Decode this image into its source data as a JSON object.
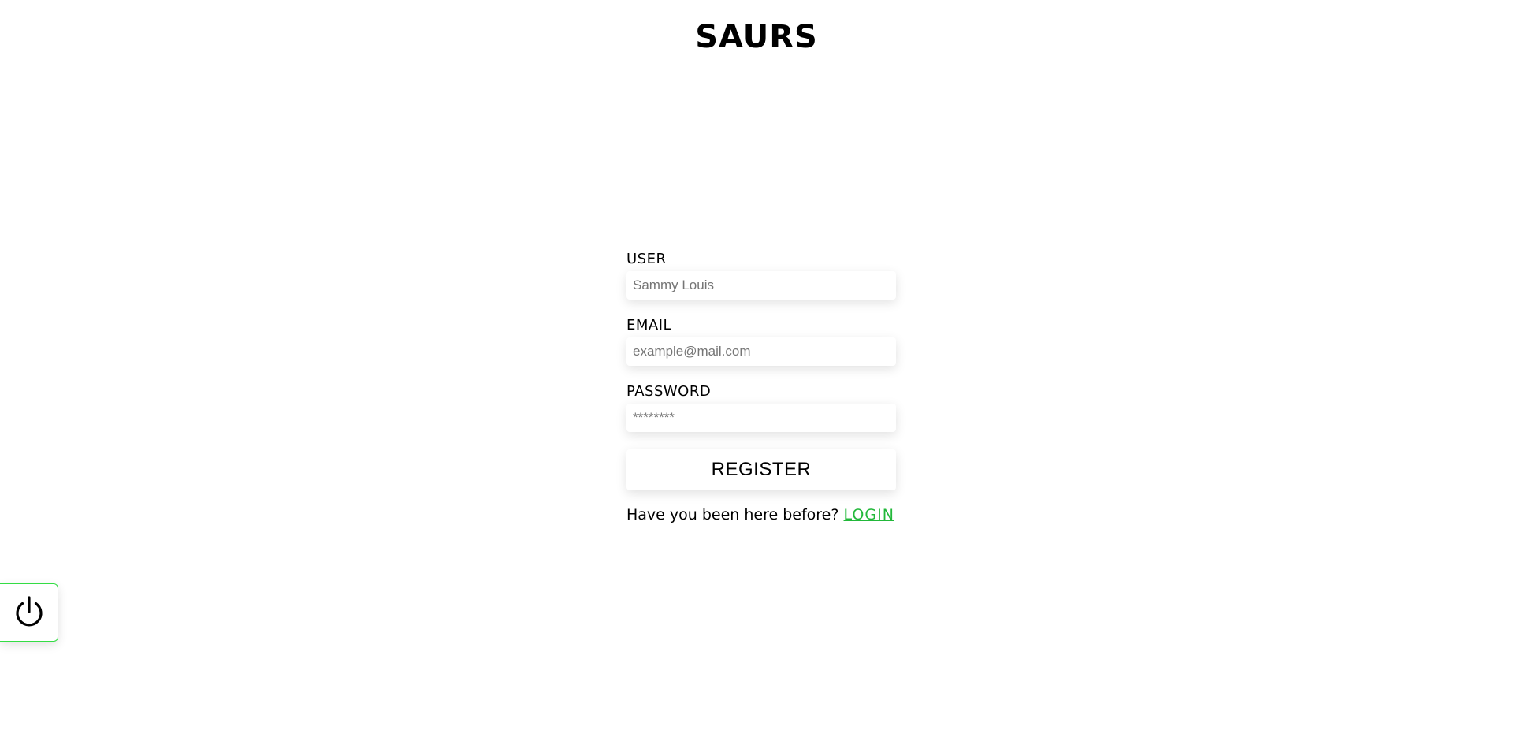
{
  "app": {
    "title": "SAURS"
  },
  "form": {
    "user": {
      "label": "USER",
      "placeholder": "Sammy Louis",
      "value": ""
    },
    "email": {
      "label": "EMAIL",
      "placeholder": "example@mail.com",
      "value": ""
    },
    "password": {
      "label": "PASSWORD",
      "placeholder": "********",
      "value": ""
    },
    "register_label": "REGISTER",
    "login_prompt": "Have you been here before?",
    "login_link": "LOGIN"
  },
  "power_button": {
    "icon": "power-icon"
  },
  "colors": {
    "accent_green": "#22b83a",
    "power_border": "#33dd44"
  }
}
